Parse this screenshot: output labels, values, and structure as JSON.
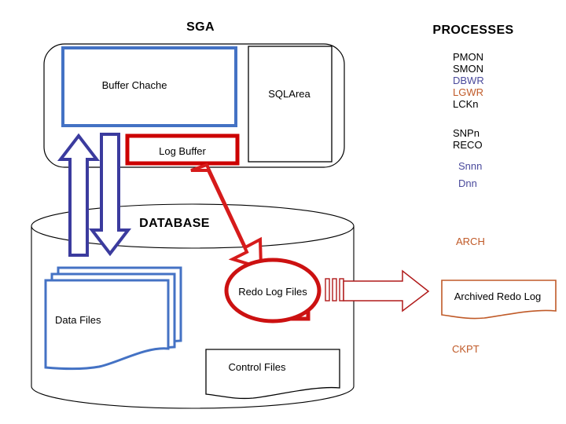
{
  "diagram": {
    "title_sga": "SGA",
    "title_processes": "PROCESSES",
    "title_database": "DATABASE"
  },
  "sga": {
    "boxes": [
      {
        "id": "buffer-cache",
        "label": "Buffer Chache",
        "border_color": "#4472c4"
      },
      {
        "id": "sql-area",
        "label": "SQLArea",
        "border_color": "#000000"
      },
      {
        "id": "log-buffer",
        "label": "Log Buffer",
        "border_color": "#cc0000"
      }
    ]
  },
  "database": {
    "label": "DATABASE",
    "items": [
      {
        "id": "data-files",
        "label": "Data Files",
        "border_color": "#4472c4"
      },
      {
        "id": "redo-log-files",
        "label": "Redo Log Files",
        "border_color": "#cc1111"
      },
      {
        "id": "control-files",
        "label": "Control Files",
        "border_color": "#000000"
      }
    ]
  },
  "archive": {
    "label": "Archived Redo Log",
    "border_color": "#c05a28"
  },
  "processes": {
    "heading": "PROCESSES",
    "groups": [
      {
        "items": [
          {
            "name": "PMON",
            "color_class": "proc-black"
          },
          {
            "name": "SMON",
            "color_class": "proc-black"
          },
          {
            "name": "DBWR",
            "color_class": "proc-blue"
          },
          {
            "name": "LGWR",
            "color_class": "proc-orange"
          },
          {
            "name": "LCKn",
            "color_class": "proc-black"
          }
        ]
      },
      {
        "items": [
          {
            "name": "SNPn",
            "color_class": "proc-black"
          },
          {
            "name": "RECO",
            "color_class": "proc-black"
          }
        ]
      },
      {
        "items": [
          {
            "name": "Snnn",
            "color_class": "proc-blue"
          },
          {
            "name": "Dnn",
            "color_class": "proc-blue"
          }
        ]
      }
    ],
    "arch_label": "ARCH",
    "ckpt_label": "CKPT"
  },
  "colors": {
    "box_blue": "#4472c4",
    "arrow_navy": "#3b3b9e",
    "red": "#cc1111",
    "dark_red": "#b01a1a",
    "orange": "#c05a28",
    "black": "#000000"
  }
}
